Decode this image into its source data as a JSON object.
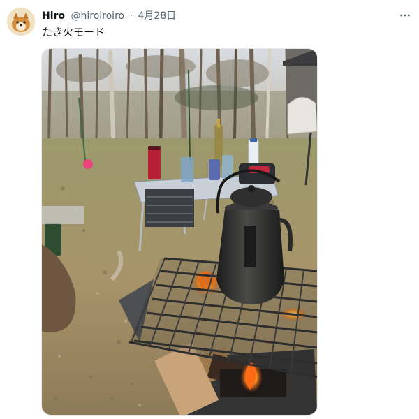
{
  "post": {
    "author": {
      "display_name": "Hiro",
      "handle": "@hiroiroiro",
      "avatar_icon": "dog-avatar-icon"
    },
    "separator": "·",
    "date": "4月28日",
    "text": "たき火モード",
    "more_icon": "more-horizontal-icon",
    "media": {
      "alt_description": "",
      "kettle_icon": "kettle",
      "colors": {
        "sky": "#c9cdd3",
        "grass": "#a59a6e",
        "fire": "#ff7a1a",
        "grill": "#2d2d2d",
        "kettle": "#2a2a2a"
      }
    }
  },
  "colors": {
    "text_primary": "#0f1419",
    "text_secondary": "#536471",
    "background": "#ffffff"
  }
}
